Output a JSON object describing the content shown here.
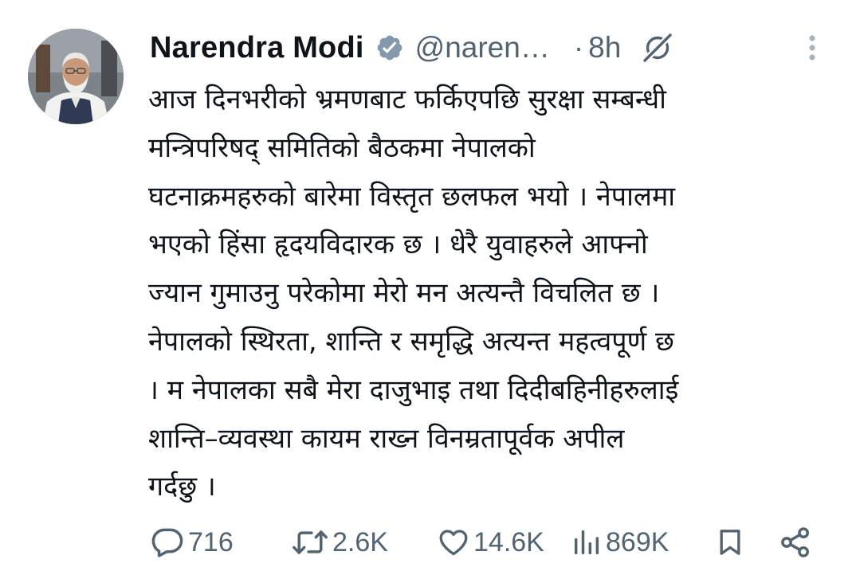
{
  "tweet": {
    "display_name": "Narendra Modi",
    "handle": "@naren…",
    "separator": "·",
    "time": "8h",
    "lines": [
      "आज दिनभरीको भ्रमणबाट फर्किएपछि सुरक्षा सम्बन्धी",
      "मन्त्रिपरिषद् समितिको बैठकमा नेपालको",
      "घटनाक्रमहरुको बारेमा विस्तृत छलफल भयो । नेपालमा",
      "भएको हिंसा हृदयविदारक छ । धेरै युवाहरुले आफ्नो",
      "ज्यान गुमाउनु परेकोमा मेरो मन अत्यन्तै विचलित छ ।",
      "नेपालको स्थिरता, शान्ति र समृद्धि अत्यन्त महत्वपूर्ण छ",
      "। म नेपालका सबै मेरा दाजुभाइ तथा दिदीबहिनीहरुलाई",
      "शान्ति–व्यवस्था कायम राख्न विनम्रतापूर्वक अपील",
      "गर्दछु ।"
    ]
  },
  "actions": {
    "replies": "716",
    "reposts": "2.6K",
    "likes": "14.6K",
    "views": "869K"
  },
  "icons": {
    "verified": "verified-badge-icon",
    "grok": "grok-icon",
    "more": "more-vertical-icon",
    "reply": "reply-icon",
    "repost": "repost-icon",
    "like": "heart-icon",
    "views": "views-icon",
    "bookmark": "bookmark-icon",
    "share": "share-icon"
  },
  "colors": {
    "text_primary": "#0f1419",
    "text_secondary": "#536471",
    "verified_badge": "#829aab",
    "background": "#ffffff"
  }
}
